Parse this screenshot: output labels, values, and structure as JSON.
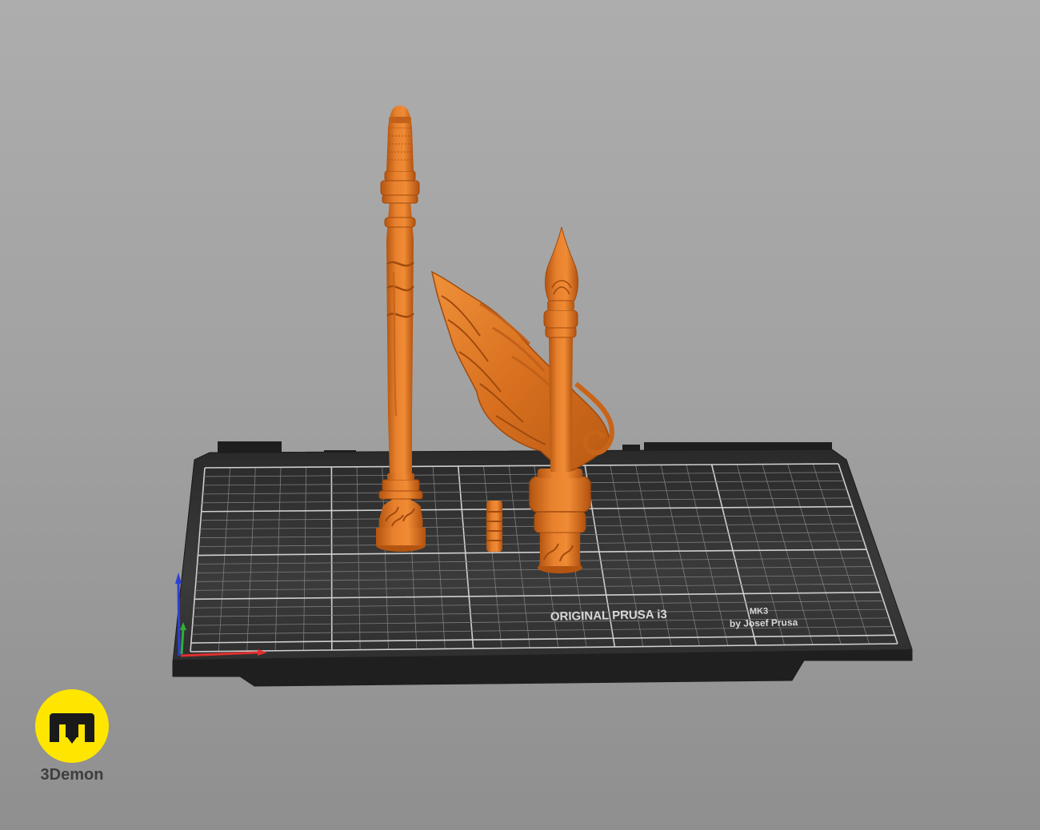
{
  "scene": {
    "background_color": "#a6a6a6",
    "model_color": "#e0792a",
    "bed_color": "#2f2f2f"
  },
  "bed": {
    "printer_name": "ORIGINAL PRUSA i3",
    "printer_model": "MK3",
    "printer_maker": "by Josef Prusa"
  },
  "axes": {
    "x_color": "#e03030",
    "y_color": "#2fae3a",
    "z_color": "#2a3fd8"
  },
  "objects": [
    {
      "name": "tall-staff-shaft"
    },
    {
      "name": "small-connector-piece"
    },
    {
      "name": "winged-staff-head"
    }
  ],
  "watermark": {
    "brand": "3Demon",
    "logo_color": "#ffe600",
    "icon": "3demon-logo-icon"
  }
}
